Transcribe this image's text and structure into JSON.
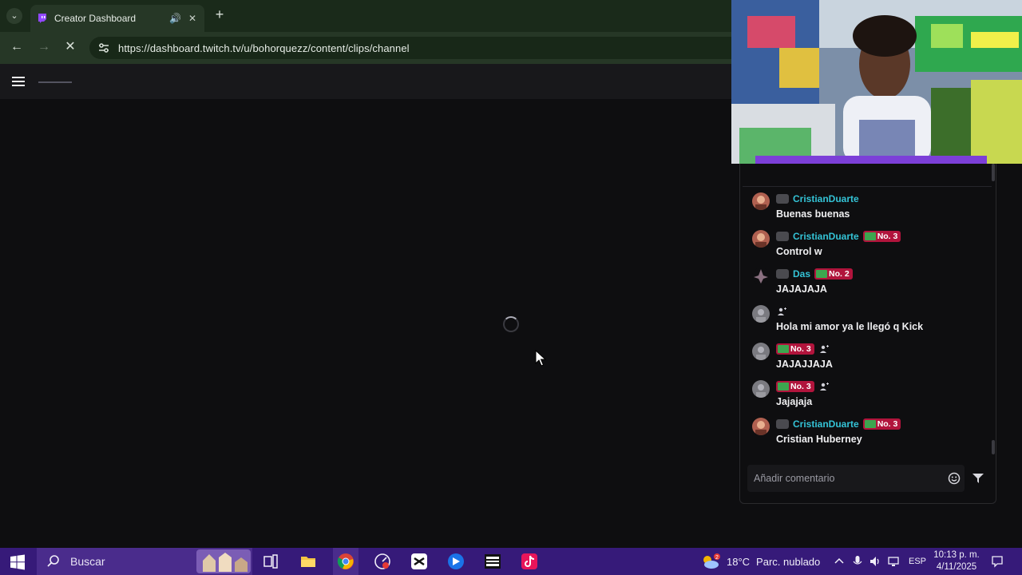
{
  "browser": {
    "tab_title": "Creator Dashboard",
    "url": "https://dashboard.twitch.tv/u/bohorquezz/content/clips/channel"
  },
  "chat": {
    "messages": [
      {
        "user": "CristianDuarte",
        "rank": "",
        "text": "Buenas buenas"
      },
      {
        "user": "CristianDuarte",
        "rank": "No. 3",
        "text": "Control w"
      },
      {
        "user": "Das",
        "rank": "No. 2",
        "text": "JAJAJAJA"
      },
      {
        "user": "",
        "rank": "",
        "text": "Hola mi amor ya le llegó q Kick"
      },
      {
        "user": "",
        "rank": "No. 3",
        "text": "JAJAJJAJA"
      },
      {
        "user": "",
        "rank": "No. 3",
        "text": "Jajajaja"
      },
      {
        "user": "CristianDuarte",
        "rank": "No. 3",
        "text": "Cristian Huberney"
      }
    ],
    "input_placeholder": "Añadir comentario"
  },
  "taskbar": {
    "search_label": "Buscar",
    "weather_temp": "18°C",
    "weather_desc": "Parc. nublado",
    "weather_alert": "2",
    "language": "ESP",
    "time": "10:13 p. m.",
    "date": "4/11/2025"
  },
  "colors": {
    "taskbar": "#361a79",
    "browser_frame": "#263726",
    "username": "#34c3d6",
    "rank_badge": "#b1143c"
  }
}
